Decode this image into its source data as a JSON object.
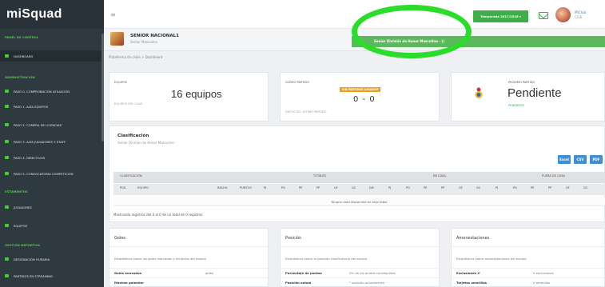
{
  "app": {
    "logo": "miSquad"
  },
  "sidebar": {
    "sections": [
      {
        "label": "PANEL DE CONTROL"
      },
      {
        "label": "ADMINISTRACIÓN"
      },
      {
        "label": "ESTAMENTOS"
      },
      {
        "label": "GESTIÓN DEPORTIVA"
      }
    ],
    "items": [
      {
        "label": "DASHBOARD",
        "icon": "dashboard-icon"
      },
      {
        "label": "PASO 0. COMPROBACIÓN AFILIACIÓN",
        "icon": "check-icon"
      },
      {
        "label": "PASO 1. ALTA EQUIPOS",
        "icon": "team-icon"
      },
      {
        "label": "PASO 2. COMPRA DE LICENCIAS",
        "icon": "cart-icon"
      },
      {
        "label": "PASO 3. ALTA JUGADORES Y STAFF",
        "icon": "user-icon"
      },
      {
        "label": "PASO 4. DIRECTIVOS",
        "icon": "users-icon"
      },
      {
        "label": "PASO 5. CONVOCATORIA COMPETICIÓN",
        "icon": "calendar-icon"
      },
      {
        "label": "JUGADORES",
        "icon": "player-icon"
      },
      {
        "label": "EQUIPOS",
        "icon": "shield-icon"
      },
      {
        "label": "DESIGNACIÓN HORARIA",
        "icon": "clock-icon"
      },
      {
        "label": "PARTIDOS EN STREAMING",
        "icon": "video-icon"
      }
    ]
  },
  "topbar": {
    "menu_icon": "≡",
    "season": "Temporada 2017/2018 ▾",
    "user_line1": "MiClub",
    "user_line2": "Club"
  },
  "team": {
    "name": "SENIOR NACIONAL1",
    "sub": "Senior Masculino",
    "notice": "Senior División de Honor Masculino - ()"
  },
  "breadcrumb": "Plataforma de clubs  >  Dashboard",
  "cards": {
    "equipos": {
      "label": "EQUIPOS",
      "value": "16 equipos",
      "sub": "EQUIPOS DEL CLUB"
    },
    "ultimo": {
      "label": "ÚLTIMO PARTIDO",
      "badge": "SIN PARTIDOS JUGADOS",
      "score": "0 - 0",
      "sub": "DATOS DEL ÚLTIMO PARTIDO"
    },
    "proximo": {
      "label": "PRÓXIMO PARTIDO",
      "value": "Pendiente",
      "status": "PENDIENTE"
    }
  },
  "clasificacion": {
    "title": "Clasificación",
    "sub": "Senior Division de Honor Masculino -",
    "buttons": {
      "excel": "Excel",
      "csv": "CSV",
      "pdf": "PDF"
    },
    "group_headers": [
      "CLASIFICACIÓN",
      "TOTALES",
      "EN CASA",
      "FUERA DE CASA"
    ],
    "columns": {
      "pos": "POS.",
      "equipo": "EQUIPO",
      "racha": "RACHA",
      "puntos": "PUNTOS",
      "stats": [
        "PJ",
        "PG",
        "PE",
        "PP",
        "GF",
        "GC",
        "DIF.",
        "PJ",
        "PG",
        "PE",
        "PP",
        "GF",
        "GC",
        "PJ",
        "PG",
        "PE",
        "PP",
        "GF",
        "GC"
      ]
    },
    "empty": "Ningún dato disponible en esta tabla",
    "info": "Mostrando registros del 0 al 0 de un total de 0 registros"
  },
  "goles": {
    "title": "Goles",
    "desc": "Estadísticas sobre los goles marcados y recibidos del equipo",
    "rows": [
      {
        "k": "Goles marcados",
        "v": "goles"
      },
      {
        "k": "Máximo goleador",
        "v": ""
      }
    ]
  },
  "posicion": {
    "title": "Posición",
    "desc": "Estadísticas sobre la posición clasificatoria del equipo",
    "rows": [
      {
        "k": "Porcentaje de puntos",
        "v": "0% de los puntos conseguidos"
      },
      {
        "k": "Posición actual",
        "v": "° posición actualmente"
      }
    ]
  },
  "amonestaciones": {
    "title": "Amonestaciones",
    "desc": "Estadísticas sobre amonestaciones del equipo",
    "rows": [
      {
        "k": "Exclusiones 2'",
        "v": "0 exclusiones"
      },
      {
        "k": "Tarjetas amarillas",
        "v": "0 amarillas"
      }
    ]
  },
  "colors": {
    "sidebar": "#2f3a40",
    "accent": "#3eae49",
    "highlight": "#2bdc2b",
    "primary": "#3f8fd6"
  }
}
